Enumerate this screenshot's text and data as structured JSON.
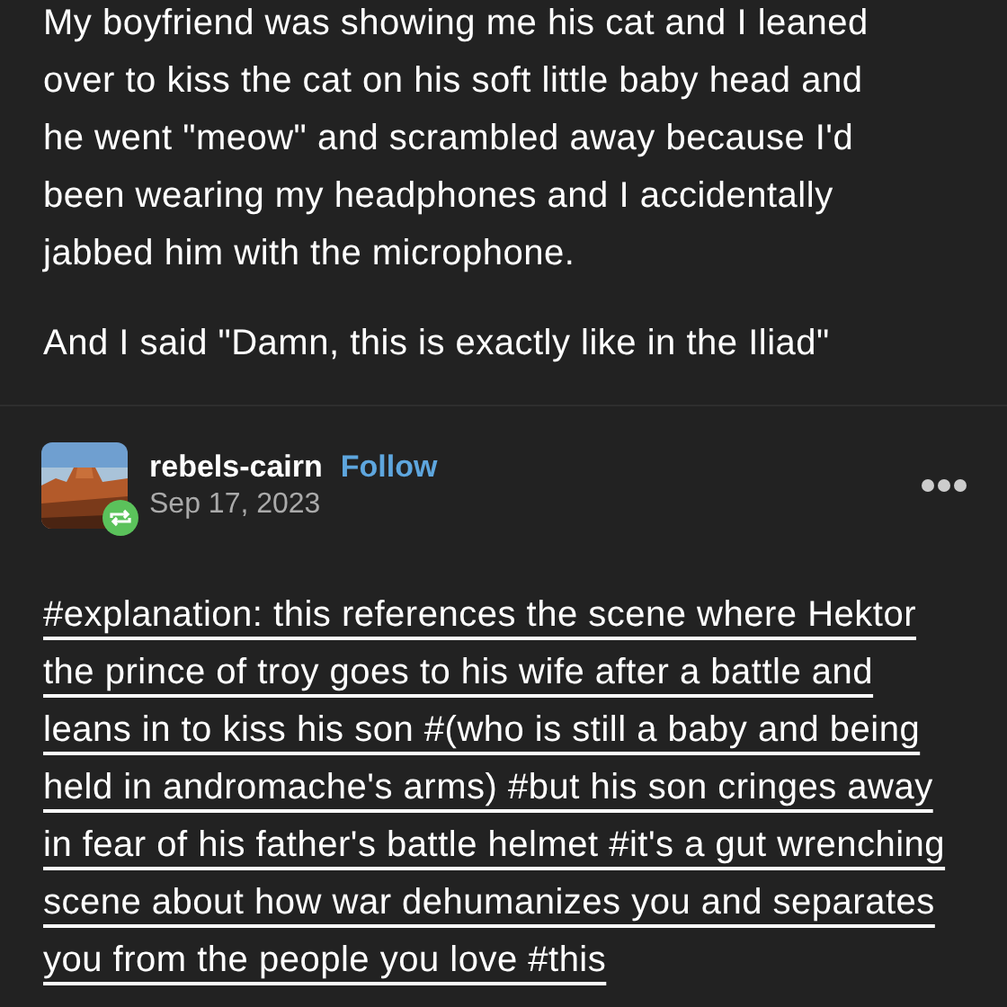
{
  "post": {
    "paragraphs": [
      "My boyfriend was showing me his cat and I leaned over to kiss the cat on his soft little baby head and he went \"meow\" and scrambled away because I'd been wearing my headphones and I accidentally jabbed him with the microphone.",
      "And I said \"Damn, this is exactly like in the Iliad\""
    ]
  },
  "reblog": {
    "username": "rebels-cairn",
    "follow": "Follow",
    "date": "Sep 17, 2023",
    "reblogged": true,
    "tags": "#explanation: this references the scene where Hektor the prince of troy goes to his wife after a battle and leans in to kiss his son #(who is still a baby and being held in andromache's arms) #but his son cringes away in fear of his father's battle helmet #it's a gut wrenching scene about how war dehumanizes you and separates you from the people you love #this"
  }
}
